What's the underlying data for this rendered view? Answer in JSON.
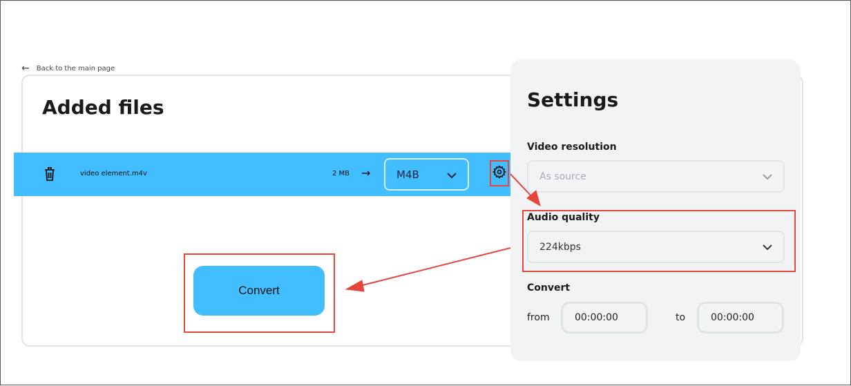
{
  "back_link": "Back to the main page",
  "title": "Added files",
  "file": {
    "name": "video element.m4v",
    "size": "2 MB",
    "format": "M4B"
  },
  "convert_button": "Convert",
  "settings": {
    "title": "Settings",
    "video_resolution_label": "Video resolution",
    "video_resolution_value": "As source",
    "audio_quality_label": "Audio quality",
    "audio_quality_value": "224kbps",
    "convert_label": "Convert",
    "from_label": "from",
    "from_value": "00:00:00",
    "to_label": "to",
    "to_value": "00:00:00"
  },
  "colors": {
    "accent": "#42bdfd",
    "annotation": "#e5453a"
  }
}
